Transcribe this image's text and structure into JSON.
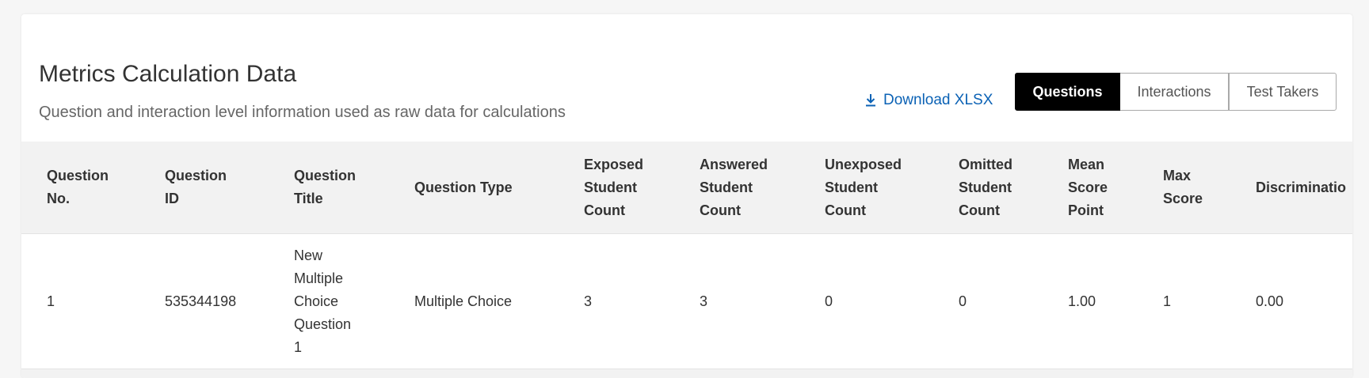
{
  "header": {
    "title": "Metrics Calculation Data",
    "subtitle": "Question and interaction level information used as raw data for calculations"
  },
  "actions": {
    "download_label": "Download XLSX",
    "download_icon": "download-icon",
    "tabs": [
      {
        "label": "Questions",
        "active": true
      },
      {
        "label": "Interactions",
        "active": false
      },
      {
        "label": "Test Takers",
        "active": false
      }
    ]
  },
  "table": {
    "columns": [
      "Question\nNo.",
      "Question\nID",
      "Question\nTitle",
      "Question Type",
      "Exposed\nStudent\nCount",
      "Answered\nStudent\nCount",
      "Unexposed\nStudent\nCount",
      "Omitted\nStudent\nCount",
      "Mean\nScore\nPoint",
      "Max\nScore",
      "Discriminatio"
    ],
    "rows": [
      [
        "1",
        "535344198",
        "New\nMultiple\nChoice\nQuestion\n1",
        "Multiple Choice",
        "3",
        "3",
        "0",
        "0",
        "1.00",
        "1",
        "0.00"
      ]
    ]
  },
  "colors": {
    "accent_link": "#0b62b5",
    "active_tab_bg": "#000000",
    "header_row_bg": "#f2f2f2"
  }
}
